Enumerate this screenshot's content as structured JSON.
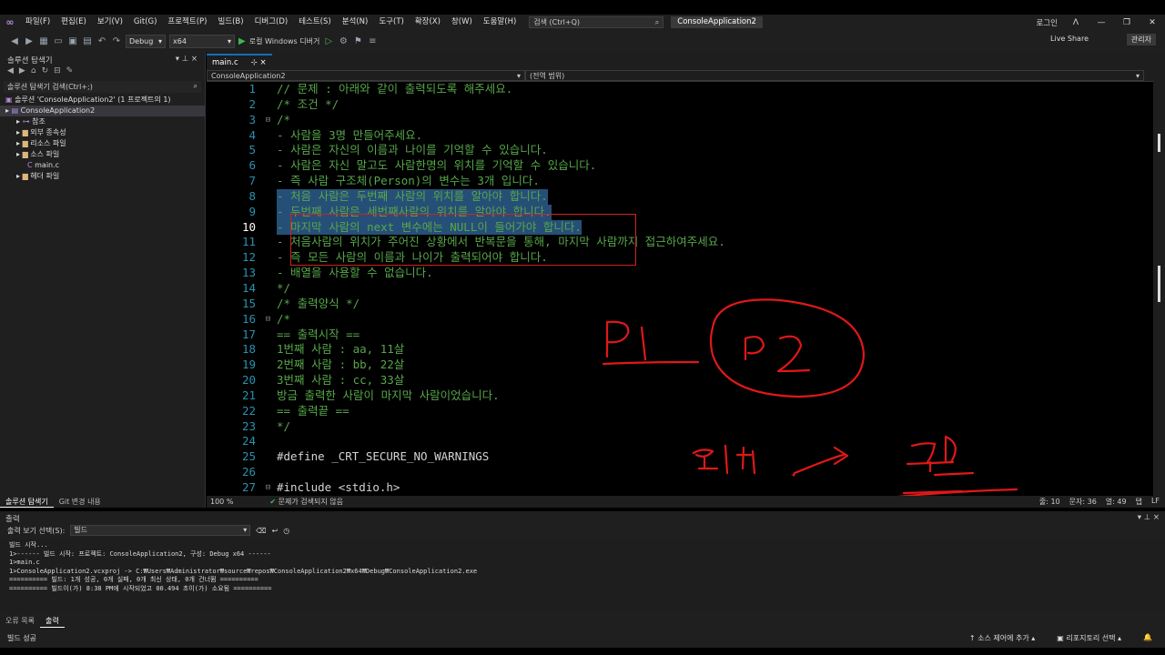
{
  "menu": {
    "items": [
      "파일(F)",
      "편집(E)",
      "보기(V)",
      "Git(G)",
      "프로젝트(P)",
      "빌드(B)",
      "디버그(D)",
      "테스트(S)",
      "분석(N)",
      "도구(T)",
      "확장(X)",
      "창(W)",
      "도움말(H)"
    ],
    "search_placeholder": "검색 (Ctrl+Q)",
    "project_title": "ConsoleApplication2",
    "login": "로그인"
  },
  "toolbar": {
    "config": "Debug",
    "platform": "x64",
    "run_label": "로컬 Windows 디버거",
    "live_share": "Live Share",
    "admin": "관리자"
  },
  "sidebar": {
    "title": "솔루션 탐색기",
    "search_placeholder": "솔루션 탐색기 검색(Ctrl+;)",
    "tree": [
      {
        "label": "솔루션 'ConsoleApplication2' (1 프로젝트의 1)",
        "depth": 0,
        "icon": "solution-icon"
      },
      {
        "label": "ConsoleApplication2",
        "depth": 0,
        "icon": "project-icon",
        "selected": true
      },
      {
        "label": "참조",
        "depth": 1,
        "icon": "references-icon"
      },
      {
        "label": "외부 종속성",
        "depth": 1,
        "icon": "folder-icon"
      },
      {
        "label": "리소스 파일",
        "depth": 1,
        "icon": "folder-icon"
      },
      {
        "label": "소스 파일",
        "depth": 1,
        "icon": "folder-icon"
      },
      {
        "label": "main.c",
        "depth": 2,
        "icon": "c-file-icon"
      },
      {
        "label": "헤더 파일",
        "depth": 1,
        "icon": "folder-icon"
      }
    ],
    "tabs": [
      "솔루션 탐색기",
      "Git 변경 내용"
    ]
  },
  "editor": {
    "tab_label": "main.c",
    "nav_project": "ConsoleApplication2",
    "nav_scope": "(전역 범위)",
    "lines": [
      {
        "n": "1",
        "text": "// 문제 : 아래와 같이 출력되도록 해주세요.",
        "kind": "comment"
      },
      {
        "n": "2",
        "text": "/* 조건 */",
        "kind": "comment"
      },
      {
        "n": "3",
        "text": "/*",
        "kind": "comment",
        "fold": "⊟"
      },
      {
        "n": "4",
        "text": "- 사람을 3명 만들어주세요.",
        "kind": "comment"
      },
      {
        "n": "5",
        "text": "- 사람은 자신의 이름과 나이를 기억할 수 있습니다.",
        "kind": "comment"
      },
      {
        "n": "6",
        "text": "- 사람은 자신 말고도 사람한명의 위치를 기억할 수 있습니다.",
        "kind": "comment"
      },
      {
        "n": "7",
        "text": "- 즉 사람 구조체(Person)의 변수는 3개 입니다.",
        "kind": "comment"
      },
      {
        "n": "8",
        "text": "- 처음 사람은 두번째 사람의 위치를 알아야 합니다.",
        "kind": "comment",
        "hl": true
      },
      {
        "n": "9",
        "text": "- 두번째 사람은 세번째사람의 위치를 알아야 합니다.",
        "kind": "comment",
        "hl": true
      },
      {
        "n": "10",
        "text": "- 마지막 사람의 next 변수에는 NULL이 들어가야 합니다.",
        "kind": "comment",
        "hl": true,
        "current": true
      },
      {
        "n": "11",
        "text": "- 처음사람의 위치가 주어진 상황에서 반복문을 통해, 마지막 사람까지 접근하여주세요.",
        "kind": "comment"
      },
      {
        "n": "12",
        "text": "- 즉 모든 사람의 이름과 나이가 출력되어야 합니다.",
        "kind": "comment"
      },
      {
        "n": "13",
        "text": "- 배열을 사용할 수 없습니다.",
        "kind": "comment"
      },
      {
        "n": "14",
        "text": "*/",
        "kind": "comment"
      },
      {
        "n": "15",
        "text": "/* 출력양식 */",
        "kind": "comment"
      },
      {
        "n": "16",
        "text": "/*",
        "kind": "comment",
        "fold": "⊟"
      },
      {
        "n": "17",
        "text": "== 출력시작 ==",
        "kind": "comment"
      },
      {
        "n": "18",
        "text": "1번째 사람 : aa, 11살",
        "kind": "comment"
      },
      {
        "n": "19",
        "text": "2번째 사람 : bb, 22살",
        "kind": "comment"
      },
      {
        "n": "20",
        "text": "3번째 사람 : cc, 33살",
        "kind": "comment"
      },
      {
        "n": "21",
        "text": "방금 출력한 사람이 마지막 사람이었습니다.",
        "kind": "comment"
      },
      {
        "n": "22",
        "text": "== 출력끝 ==",
        "kind": "comment"
      },
      {
        "n": "23",
        "text": "*/",
        "kind": "comment"
      },
      {
        "n": "24",
        "text": "",
        "kind": "code"
      },
      {
        "n": "25",
        "text": "#define _CRT_SECURE_NO_WARNINGS",
        "kind": "code"
      },
      {
        "n": "26",
        "text": "",
        "kind": "code"
      },
      {
        "n": "27",
        "text": "#include <stdio.h>",
        "kind": "code",
        "fold": "⊟"
      }
    ],
    "zoom": "100 %",
    "issues": "문제가 검색되지 않음",
    "position": {
      "line": "줄: 10",
      "char": "문자: 36",
      "col": "열: 49",
      "mode": "탭",
      "eol": "LF"
    }
  },
  "output": {
    "title": "출력",
    "source_label": "출력 보기 선택(S):",
    "source_value": "빌드",
    "lines": [
      "빌드 시작...",
      "1>------ 빌드 시작: 프로젝트: ConsoleApplication2, 구성: Debug x64 ------",
      "1>main.c",
      "1>ConsoleApplication2.vcxproj -> C:₩Users₩Administrator₩source₩repos₩ConsoleApplication2₩x64₩Debug₩ConsoleApplication2.exe",
      "========== 빌드: 1개 성공, 0개 실패, 0개 최신 상태, 0개 건너뜀 ==========",
      "========== 빌드이(가) 8:38 PM에 시작되었고 00.494 초이(가) 소요됨 =========="
    ],
    "tabs": [
      "오류 목록",
      "출력"
    ]
  },
  "statusbar": {
    "left": "빌드 성공",
    "source_control": "소스 제어에 추가",
    "repo": "리포지토리 선택"
  },
  "colors": {
    "ink": "#e01818",
    "selection": "#264f78",
    "comment": "#57a64a"
  }
}
